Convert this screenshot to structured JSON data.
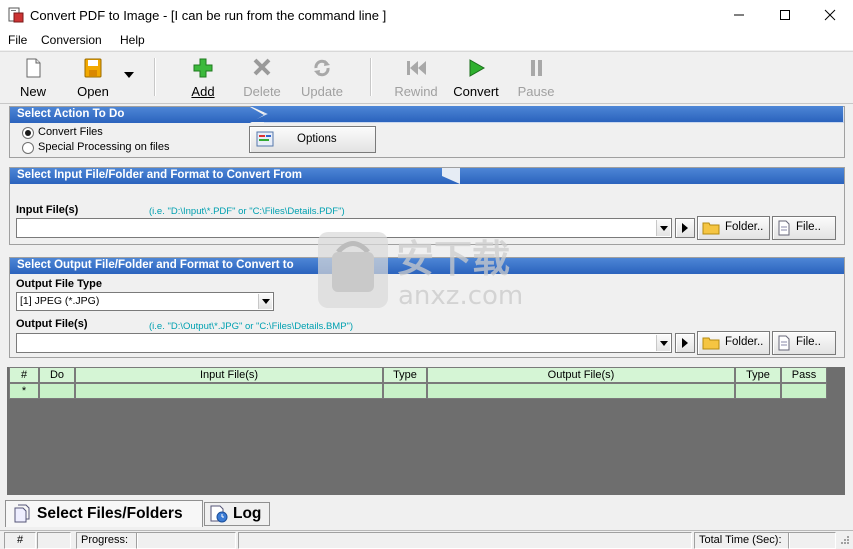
{
  "window": {
    "title": "Convert PDF to Image - [I can be run from the command line ]"
  },
  "menu": [
    "File",
    "Conversion",
    "Help"
  ],
  "toolbar": {
    "new": "New",
    "open": "Open",
    "add": "Add",
    "delete": "Delete",
    "update": "Update",
    "rewind": "Rewind",
    "convert": "Convert",
    "pause": "Pause"
  },
  "action_panel": {
    "title": "Select Action To Do",
    "radio_convert": "Convert Files",
    "radio_special": "Special Processing on files",
    "options_button": "Options",
    "selected": "convert"
  },
  "input_panel": {
    "title": "Select Input File/Folder and Format to Convert From",
    "label": "Input File(s)",
    "hint": "(i.e. \"D:\\Input\\*.PDF\"  or \"C:\\Files\\Details.PDF\")",
    "value": "",
    "folder_button": "Folder..",
    "file_button": "File.."
  },
  "output_panel": {
    "title": "Select Output File/Folder and Format to Convert to",
    "type_label": "Output File Type",
    "type_value": "[1] JPEG (*.JPG)",
    "label": "Output File(s)",
    "hint": "(i.e. \"D:\\Output\\*.JPG\"  or \"C:\\Files\\Details.BMP\")",
    "value": "",
    "folder_button": "Folder..",
    "file_button": "File.."
  },
  "grid": {
    "columns": [
      "#",
      "Do",
      "Input File(s)",
      "Type",
      "Output File(s)",
      "Type",
      "Pass"
    ],
    "new_row_marker": "*"
  },
  "tabs": [
    "Select Files/Folders",
    "Log"
  ],
  "status": {
    "hash": "#",
    "progress": "Progress:",
    "total_time": "Total Time (Sec):"
  },
  "watermark": {
    "text": "安下载",
    "sub": "anxz.com"
  }
}
